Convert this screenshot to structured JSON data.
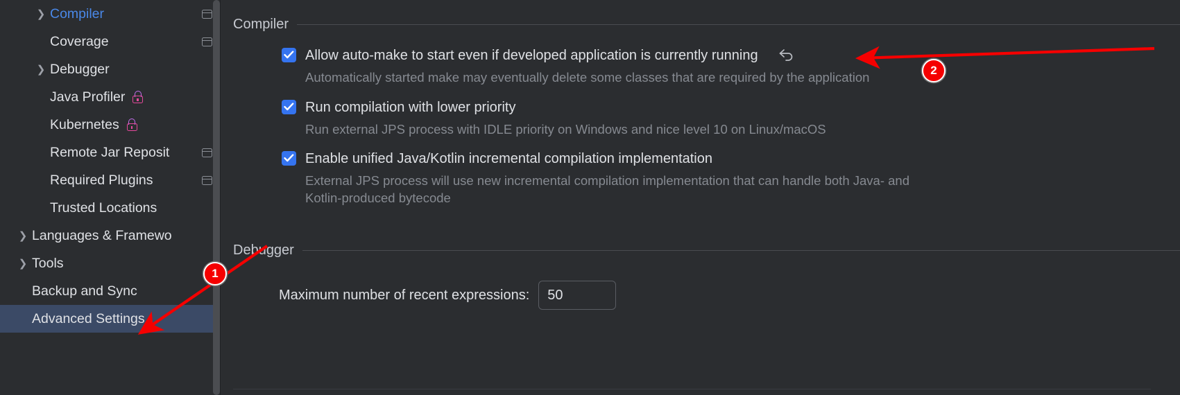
{
  "sidebar": {
    "items": [
      {
        "label": "Compiler",
        "indent": 1,
        "chevron": true,
        "badge": "window",
        "selected": false,
        "accent": true
      },
      {
        "label": "Coverage",
        "indent": 1,
        "chevron": false,
        "badge": "window",
        "selected": false,
        "accent": false
      },
      {
        "label": "Debugger",
        "indent": 1,
        "chevron": true,
        "badge": "none",
        "selected": false,
        "accent": false
      },
      {
        "label": "Java Profiler",
        "indent": 1,
        "chevron": false,
        "badge": "lock",
        "selected": false,
        "accent": false
      },
      {
        "label": "Kubernetes",
        "indent": 1,
        "chevron": false,
        "badge": "lock",
        "selected": false,
        "accent": false
      },
      {
        "label": "Remote Jar Reposit",
        "indent": 1,
        "chevron": false,
        "badge": "window",
        "selected": false,
        "accent": false
      },
      {
        "label": "Required Plugins",
        "indent": 1,
        "chevron": false,
        "badge": "window",
        "selected": false,
        "accent": false
      },
      {
        "label": "Trusted Locations",
        "indent": 1,
        "chevron": false,
        "badge": "none",
        "selected": false,
        "accent": false
      },
      {
        "label": "Languages & Framewo",
        "indent": 0,
        "chevron": true,
        "badge": "none",
        "selected": false,
        "accent": false
      },
      {
        "label": "Tools",
        "indent": 0,
        "chevron": true,
        "badge": "none",
        "selected": false,
        "accent": false
      },
      {
        "label": "Backup and Sync",
        "indent": 0,
        "chevron": false,
        "badge": "none",
        "selected": false,
        "accent": false
      },
      {
        "label": "Advanced Settings",
        "indent": 0,
        "chevron": false,
        "badge": "none",
        "selected": true,
        "accent": false
      }
    ]
  },
  "content": {
    "compiler": {
      "title": "Compiler",
      "options": [
        {
          "label": "Allow auto-make to start even if developed application is currently running",
          "checked": true,
          "has_undo": true,
          "description": "Automatically started make may eventually delete some classes that are required by the application"
        },
        {
          "label": "Run compilation with lower priority",
          "checked": true,
          "has_undo": false,
          "description": "Run external JPS process with IDLE priority on Windows and nice level 10 on Linux/macOS"
        },
        {
          "label": "Enable unified Java/Kotlin incremental compilation implementation",
          "checked": true,
          "has_undo": false,
          "description": "External JPS process will use new incremental compilation implementation that can handle both Java- and Kotlin-produced bytecode"
        }
      ]
    },
    "debugger": {
      "title": "Debugger",
      "field_label": "Maximum number of recent expressions:",
      "field_value": "50",
      "field_placeholder": ""
    }
  },
  "annotations": {
    "markers": [
      {
        "number": "1"
      },
      {
        "number": "2"
      }
    ],
    "color": "#f50000"
  },
  "colors": {
    "background": "#2b2d30",
    "accent_blue": "#3574f0",
    "selection": "#3b4a66",
    "link": "#4a88e8",
    "muted_text": "#868a91",
    "primary_text": "#dfe1e5",
    "annotation_red": "#f50000"
  }
}
